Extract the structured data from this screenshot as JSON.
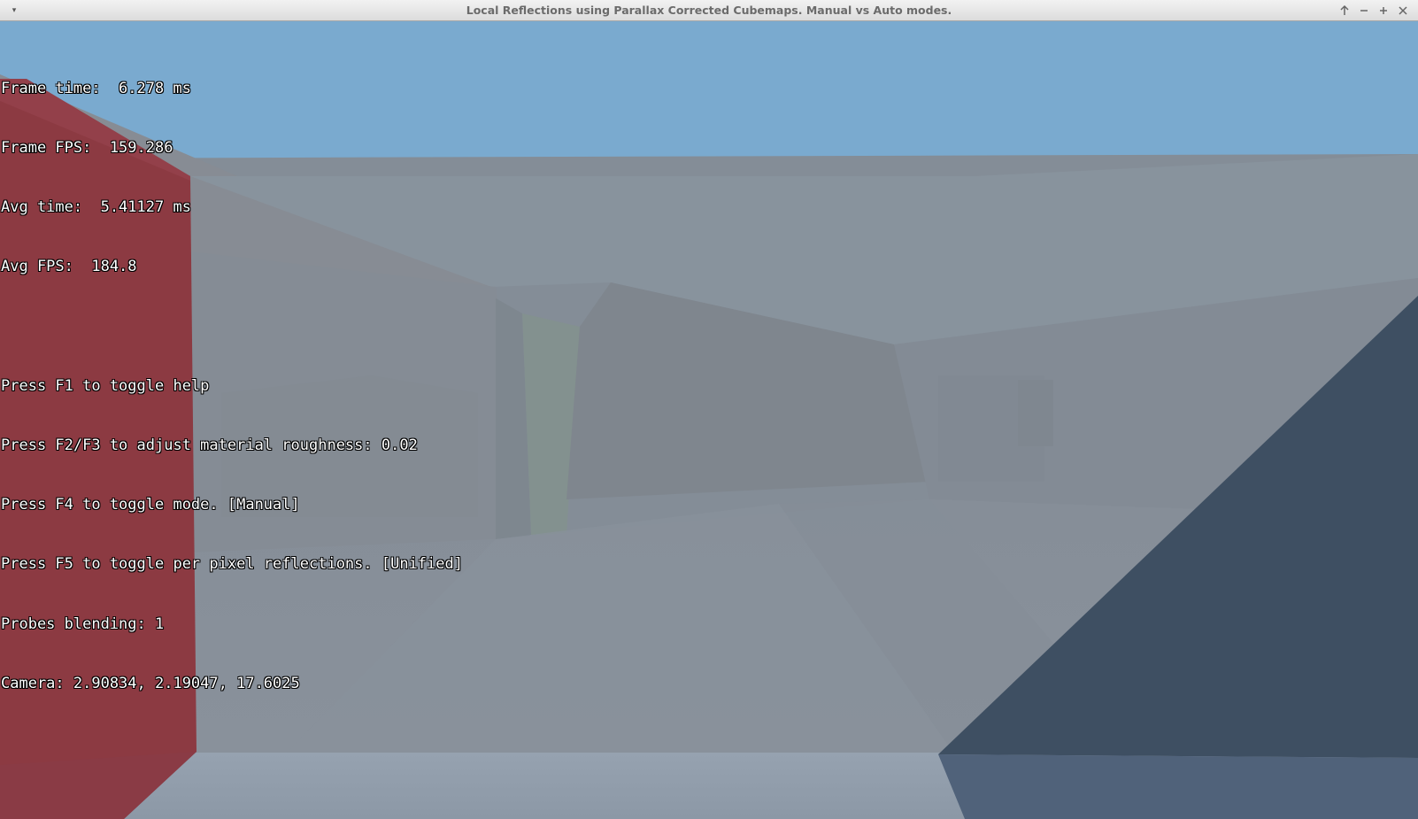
{
  "window": {
    "title": "Local Reflections using Parallax Corrected Cubemaps. Manual vs Auto modes.",
    "menu_glyph": "▾",
    "buttons": [
      "shade",
      "minimize",
      "maximize",
      "close"
    ]
  },
  "overlay": {
    "frame_time": "Frame time:  6.278 ms",
    "frame_fps": "Frame FPS:  159.286",
    "avg_time": "Avg time:  5.41127 ms",
    "avg_fps": "Avg FPS:  184.8",
    "help_f1": "Press F1 to toggle help",
    "help_f2f3": "Press F2/F3 to adjust material roughness: 0.02",
    "help_f4": "Press F4 to toggle mode. [Manual]",
    "help_f5": "Press F5 to toggle per pixel reflections. [Unified]",
    "probes_blending": "Probes blending: 1",
    "camera": "Camera: 2.90834, 2.19047, 17.6025"
  },
  "colors": {
    "sky": "#7aaacf",
    "walls": "#848c96",
    "floor": "#8a939d",
    "red_box": "#8b3a42",
    "dark_panel": "#3d4e60",
    "titlebar": "#e6e6e6"
  }
}
